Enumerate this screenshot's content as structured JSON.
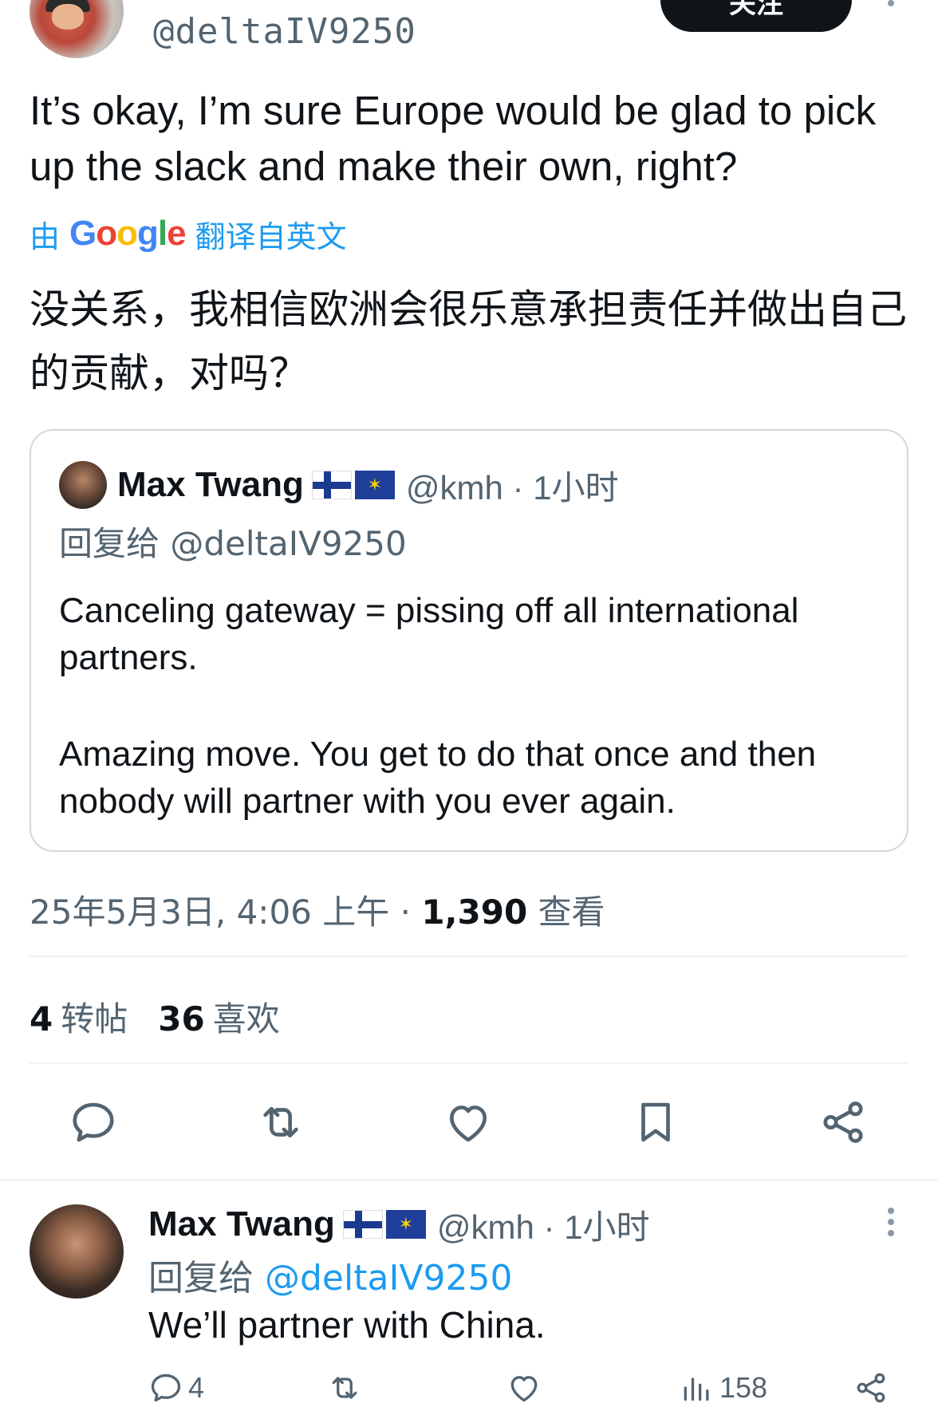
{
  "top_user": {
    "handle": "@deltaIV9250",
    "follow_label": "关注"
  },
  "tweet": {
    "text": "It’s okay, I’m sure Europe would be glad to pick up the slack and make their own, right?",
    "translate_by": "由",
    "translate_provider": "Google",
    "translate_label": "翻译自英文",
    "translated_text": "没关系，我相信欧洲会很乐意承担责任并做出自己的贡献，对吗？"
  },
  "quote": {
    "name": "Max Twang",
    "handle_time": "@kmh · 1小时",
    "reply_to": "回复给 @deltaIV9250",
    "paragraphs": [
      "Canceling gateway = pissing off all international partners.",
      "Amazing move. You get to do that once and then nobody will partner with you ever again."
    ]
  },
  "meta": {
    "timestamp": "25年5月3日, 4:06 上午 · ",
    "views_count": "1,390",
    "views_label": " 查看"
  },
  "stats": {
    "reposts_count": "4",
    "reposts_label": "转帖",
    "likes_count": "36",
    "likes_label": "喜欢"
  },
  "actions": {
    "icons": [
      "reply-icon",
      "repost-icon",
      "like-icon",
      "bookmark-icon",
      "share-icon"
    ]
  },
  "reply": {
    "name": "Max Twang",
    "handle_time": "@kmh · 1小时",
    "reply_prefix": "回复给 ",
    "reply_mention": "@deltaIV9250",
    "text": "We’ll partner with China.",
    "reply_count": "4",
    "views_count": "158"
  },
  "colors": {
    "accent": "#1d9bf0",
    "text": "#0f1419",
    "muted": "#536471",
    "border": "#cfd9de"
  }
}
